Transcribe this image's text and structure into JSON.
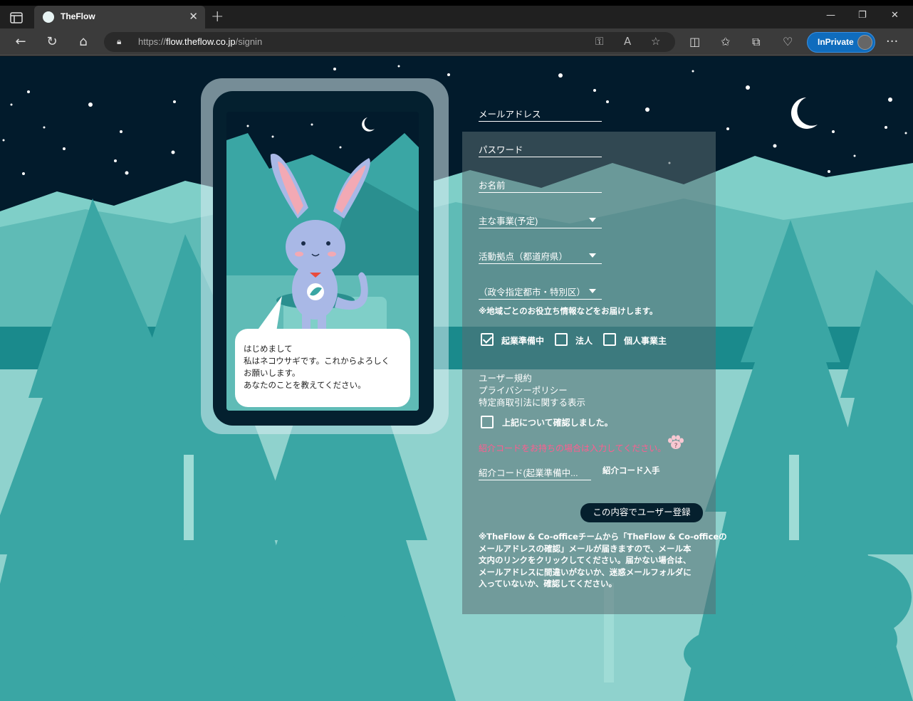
{
  "browser": {
    "tab_title": "TheFlow",
    "url_prefix": "https://",
    "url_host": "flow.theflow.co.jp",
    "url_path": "/signin",
    "inprivate_label": "InPrivate"
  },
  "bubble": {
    "lines": [
      "はじめまして",
      "私はネコウサギです。これからよろしく",
      "お願いします。",
      "あなたのことを教えてください。"
    ]
  },
  "form": {
    "email_label": "メールアドレス",
    "password_label": "パスワード",
    "name_label": "お名前",
    "business_label": "主な事業(予定)",
    "prefecture_label": "活動拠点（都道府県）",
    "city_label": "（政令指定都市・特別区）",
    "region_note": "※地域ごとのお役立ち情報などをお届けします。",
    "checkbox_startup": "起業準備中",
    "checkbox_corporation": "法人",
    "checkbox_sole": "個人事業主",
    "startup_checked": true,
    "corporation_checked": false,
    "sole_checked": false,
    "link_terms": "ユーザー規約",
    "link_privacy": "プライバシーポリシー",
    "link_commerce": "特定商取引法に関する表示",
    "confirm_label": "上記について確認しました。",
    "confirm_checked": false,
    "referral_hint": "紹介コードをお持ちの場合は入力してください。",
    "referral_label": "紹介コード(起業準備中...",
    "get_referral": "紹介コード入手",
    "submit_label": "この内容でユーザー登録",
    "email_note_lines": [
      "※TheFlow & Co-officeチームから「TheFlow & Co-officeの",
      "メールアドレスの確認」メールが届きますので、メール本",
      "文内のリンクをクリックしてください。届かない場合は、",
      "メールアドレスに間違いがないか、迷惑メールフォルダに",
      "入っていないか、確認してください。"
    ]
  },
  "colors": {
    "sky": "#021b2c",
    "mountain": "#7fcfc8",
    "tree": "#3aa6a4",
    "phone_bg": "#04202f",
    "submit_bg": "#05202e",
    "hint_pink": "#ff5d8f",
    "accent_blue": "#0f6cbd"
  }
}
